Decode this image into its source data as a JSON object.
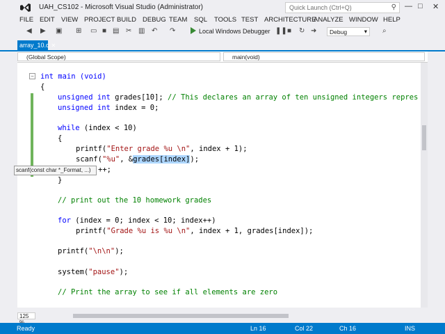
{
  "window": {
    "title": "UAH_CS102 - Microsoft Visual Studio (Administrator)",
    "quick_launch_placeholder": "Quick Launch (Ctrl+Q)"
  },
  "menu": [
    "FILE",
    "EDIT",
    "VIEW",
    "PROJECT",
    "BUILD",
    "DEBUG",
    "TEAM",
    "SQL",
    "TOOLS",
    "TEST",
    "ARCHITECTURE",
    "ANALYZE",
    "WINDOW",
    "HELP"
  ],
  "toolbar": {
    "debugger_label": "Local Windows Debugger",
    "configuration": "Debug"
  },
  "tab": {
    "label": "array_10.c"
  },
  "nav": {
    "scope": "(Global Scope)",
    "function": "main(void)"
  },
  "code": {
    "l1": "int main (void)",
    "l2": "{",
    "l3a": "unsigned int",
    "l3b": " grades[10]; ",
    "l3c": "// This declares an array of ten unsigned integers repres",
    "l4a": "unsigned int",
    "l4b": " index = 0;",
    "l5a": "while",
    "l5b": " (index < 10)",
    "l6": "{",
    "l7a": "printf(",
    "l7b": "\"Enter grade %u \\n\"",
    "l7c": ", index + 1);",
    "l8a": "scanf(",
    "l8b": "\"%u\"",
    "l8c": ", &",
    "l8d": "grades[index]",
    "l8e": ");",
    "l9": "++;",
    "l10": "}",
    "l11": "// print out the 10 homework grades",
    "l12a": "for",
    "l12b": " (index = 0; index < 10; index++)",
    "l13a": "printf(",
    "l13b": "\"Grade %u is %u \\n\"",
    "l13c": ", index + 1, grades[index]);",
    "l14a": "printf(",
    "l14b": "\"\\n\\n\"",
    "l14c": ");",
    "l15a": "system(",
    "l15b": "\"pause\"",
    "l15c": ");",
    "l16": "// Print the array to see if all elements are zero"
  },
  "tooltip": "scanf(const char *_Format, ...)",
  "zoom": "125 %",
  "status": {
    "ready": "Ready",
    "line": "Ln 16",
    "col": "Col 22",
    "ch": "Ch 16",
    "ins": "INS"
  },
  "colors": {
    "accent": "#007acc",
    "keyword": "#0000ff",
    "string": "#a31515",
    "comment": "#008000"
  }
}
